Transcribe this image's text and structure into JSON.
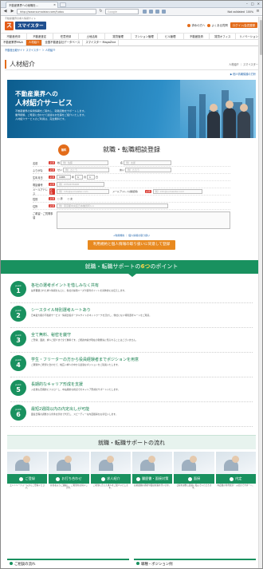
{
  "browser": {
    "tab_title": "不動産業界への就職を…",
    "url": "http://www.sumaistar.com/fudou",
    "search_placeholder": "Google",
    "status": "Not validated",
    "zoom": "100%"
  },
  "site": {
    "top_line": "不動産業界の求人情報サイト",
    "logo": "スマイスター",
    "links": {
      "recruit": "求めの方へ",
      "faq": "よくある質問",
      "login": "ログイン/会員登録"
    }
  },
  "gnav": {
    "row1": [
      "不動産売却",
      "不動産査定",
      "任意売却",
      "土地活用",
      "賃貸管理",
      "マンション管理",
      "ビル管理",
      "不動産投資",
      "賃貸オフィス",
      "リノベーション"
    ],
    "row2": [
      "不動産業界M&A",
      "人材紹介",
      "全国不動産会社データベース",
      "スマイスター MagaZine"
    ]
  },
  "breadcrumb": "不動産比較サイト スマイスター ＞ 人材紹介",
  "page_title": "人材紹介",
  "page_title_right": "人材紹介 ｜ スマイスター",
  "privacy_link": "▶ 個人情報保護の方針",
  "hero": {
    "line1": "不動産業界への",
    "line2": "人材紹介サービス",
    "d1": "不動産業界の採用情報をご案内し、就職活動をサポートします。",
    "d2": "業界経験、ご希望に合わせて最適なお仕事をご紹介いたします。",
    "d3": "人材紹介サービスのご利用は、完全無料です。"
  },
  "form": {
    "badge": "無料",
    "title": "就職・転職相談登録",
    "req": "必須",
    "rows": {
      "name": {
        "label": "名前",
        "sei": "例）佐藤",
        "mei": "例）太郎",
        "sei_l": "姓",
        "mei_l": "名"
      },
      "kana": {
        "label": "ふりがな",
        "sei": "例）さとう",
        "mei": "例）たろう",
        "sei_l": "せい",
        "mei_l": "めい"
      },
      "birth": {
        "label": "生年月日",
        "year": "1985",
        "y": "年",
        "month": "1",
        "m": "月",
        "day": "1",
        "d": "日"
      },
      "tel": {
        "label": "電話番号",
        "value": "例）0354476268"
      },
      "mail": {
        "label": "メールアドレス",
        "value": "例）info@sumaistar.com",
        "label2": "メールアドレス(確認用)",
        "value2": "例）info@sumaistar.com"
      },
      "sex": {
        "label": "性別",
        "m": "男",
        "f": "女"
      },
      "addr": {
        "label": "住所",
        "value": "例）東京都中央区日本橋兜町1-1"
      },
      "note": {
        "label": "ご希望・ご質問事項"
      }
    },
    "agree": "→利用規約 ｜ 個人情報の取り扱い",
    "submit": "利用規約と個人情報の取り扱いに同意して登録"
  },
  "points": {
    "title_a": "就職・転職サポートの",
    "title_b": "6つ",
    "title_c": "のポイント",
    "items": [
      {
        "label": "point",
        "num": "1",
        "title": "各社の選考ポイントを惜しみなく共有",
        "desc": "長年蓄積された求人情報をもとに、各社の採用ニーズや選考ポイントを具体的にお伝えします。"
      },
      {
        "label": "point",
        "num": "2",
        "title": "シースタイル特別選考ルートあり",
        "desc": "日本最大級の不動産サービス・情報比較ポータルサイトのネットワークを活かし、他社にない特別選考ルートをご用意。"
      },
      {
        "label": "point",
        "num": "3",
        "title": "全て無料、秘密を厳守",
        "desc": "ご登録、面談、求人ご紹介まで全て無料です。ご相談内容が現在の勤務先に知られることはございません。"
      },
      {
        "label": "point",
        "num": "4",
        "title": "学生・フリーターの方から役員経験者までポジションを用意",
        "desc": "ご経験やご希望に合わせて、幅広い求人の中から最適なポジションをご提案いたします。"
      },
      {
        "label": "point",
        "num": "5",
        "title": "長期的なキャリア形成を支援",
        "desc": "入社後も定期的にフォローし、中長期的な視点でのキャリア形成をサポートいたします。"
      },
      {
        "label": "point",
        "num": "6",
        "title": "最短2週間以内の内定出しが可能",
        "desc": "面接日程の調整から条件交渉まで代行し、スピーディーな内定獲得をお手伝いします。"
      }
    ]
  },
  "flow": {
    "title": "就職・転職サポートの流れ",
    "steps": [
      {
        "name": "ご登録",
        "desc": "エントリーフォームからご登録ください。"
      },
      {
        "name": "お打ち合わせ",
        "desc": "担当者よりご連絡し、ご希望をお伺いします。"
      },
      {
        "name": "求人紹介",
        "desc": "ご希望に合った求人をご紹介いたします。"
      },
      {
        "name": "履歴書・面接対策",
        "desc": "応募書類の添削や面接対策を行います。"
      },
      {
        "name": "面接",
        "desc": "日程を調整し面接に臨んでいただきます。"
      },
      {
        "name": "内定",
        "desc": "内定後の条件交渉・入社までサポート。"
      }
    ]
  },
  "bottom": {
    "left": "ご相談の流れ",
    "right": "職種・ポジション例"
  },
  "colors": {
    "accent": "#e36c1a",
    "green": "#19915f",
    "blue": "#1a5fa8"
  }
}
